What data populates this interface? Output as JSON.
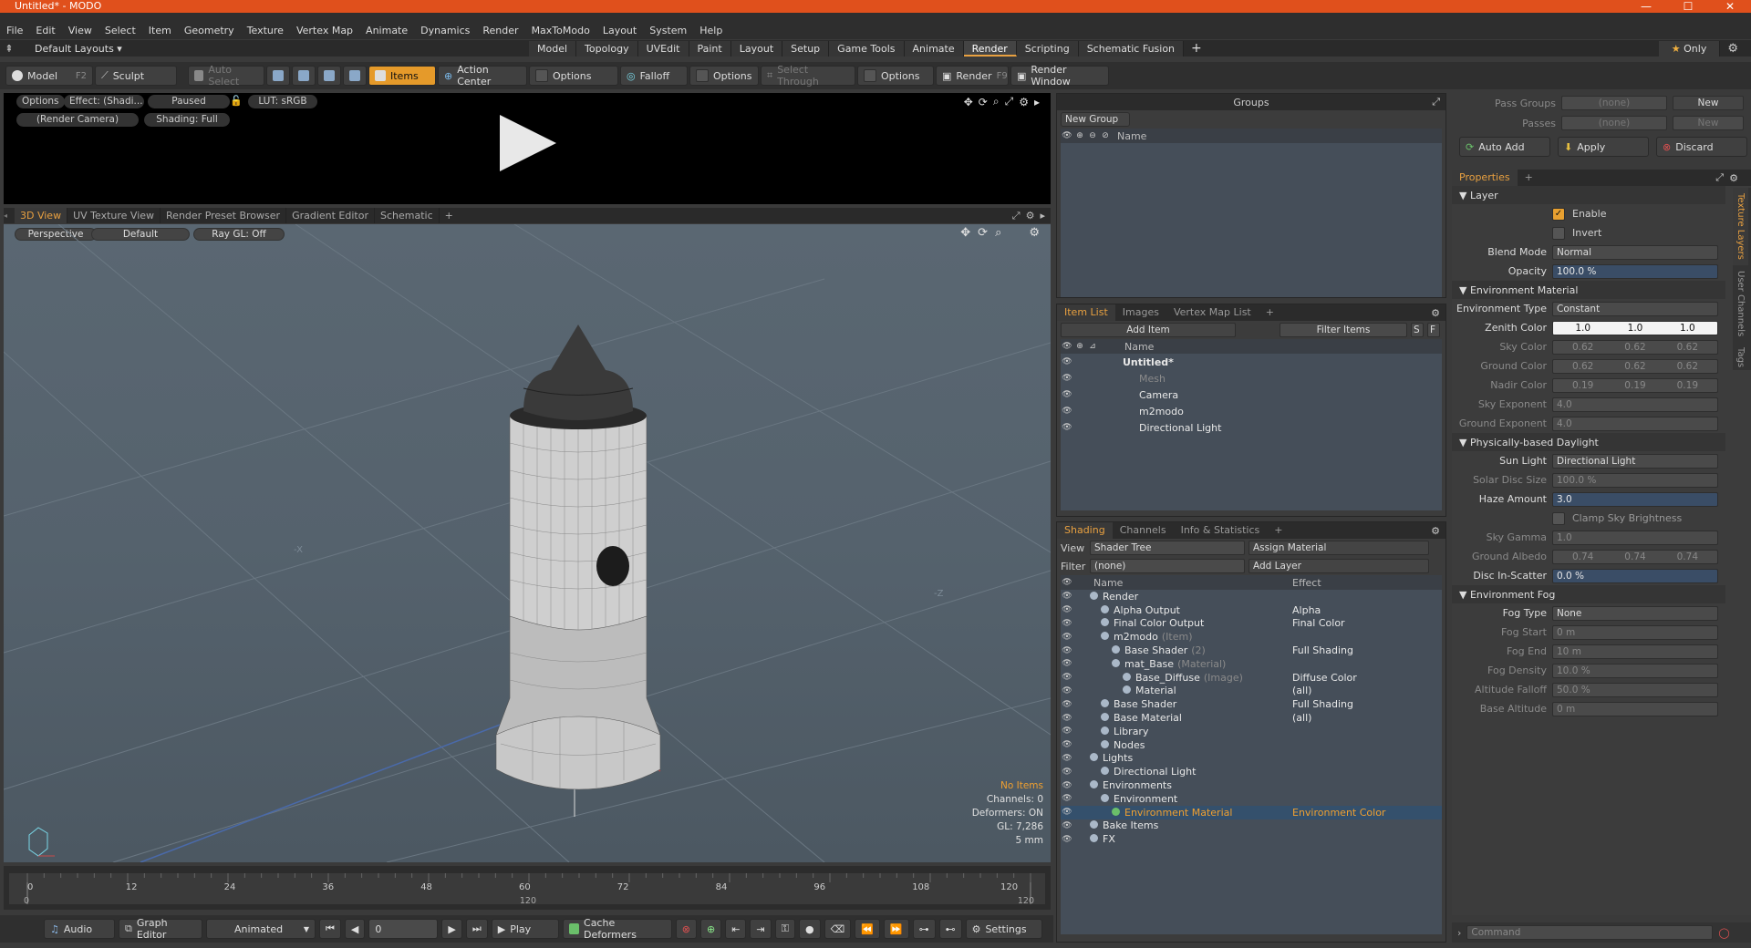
{
  "window": {
    "title": "Untitled* - MODO",
    "minimize": "—",
    "maximize": "☐",
    "close": "✕"
  },
  "menu": [
    "File",
    "Edit",
    "View",
    "Select",
    "Item",
    "Geometry",
    "Texture",
    "Vertex Map",
    "Animate",
    "Dynamics",
    "Render",
    "MaxToModo",
    "Layout",
    "System",
    "Help"
  ],
  "layouts": {
    "selector": "Default Layouts ▾",
    "tabs": [
      "Model",
      "Topology",
      "UVEdit",
      "Paint",
      "Layout",
      "Setup",
      "Game Tools",
      "Animate",
      "Render",
      "Scripting",
      "Schematic Fusion"
    ],
    "active_tab": "Render",
    "add": "+",
    "only": "Only"
  },
  "toolbar": {
    "model": "Model",
    "model_key": "F2",
    "sculpt": "Sculpt",
    "auto_select": "Auto Select",
    "items": "Items",
    "action_center": "Action Center",
    "options1": "Options",
    "falloff": "Falloff",
    "options2": "Options",
    "select_through": "Select Through",
    "options3": "Options",
    "render": "Render",
    "render_key": "F9",
    "render_window": "Render Window"
  },
  "render_view": {
    "options": "Options",
    "effect": "Effect: (Shadi...",
    "paused": "Paused",
    "lut": "LUT: sRGB",
    "camera": "(Render Camera)",
    "shading": "Shading: Full"
  },
  "viewport_tabs": [
    "3D View",
    "UV Texture View",
    "Render Preset Browser",
    "Gradient Editor",
    "Schematic"
  ],
  "viewport": {
    "perspective": "Perspective",
    "default": "Default",
    "raygl": "Ray GL: Off",
    "axis_x": "-X",
    "axis_z": "-Z",
    "info": [
      "No Items",
      "Channels: 0",
      "Deformers: ON",
      "GL: 7,286",
      "5 mm"
    ]
  },
  "timeline": {
    "ticks": [
      "0",
      "12",
      "24",
      "36",
      "48",
      "60",
      "72",
      "84",
      "96",
      "108",
      "120"
    ],
    "lower_ticks": [
      "0",
      "120",
      "120"
    ]
  },
  "bottom": {
    "audio": "Audio",
    "graph_editor": "Graph Editor",
    "animated": "Animated",
    "frame": "0",
    "play": "Play",
    "cache_deformers": "Cache Deformers",
    "settings": "Settings"
  },
  "groups": {
    "title": "Groups",
    "new_group": "New Group",
    "col_name": "Name"
  },
  "item_list": {
    "tabs": [
      "Item List",
      "Images",
      "Vertex Map List"
    ],
    "add_item": "Add Item",
    "filter": "Filter Items",
    "s": "S",
    "f": "F",
    "col_name": "Name",
    "rows": [
      {
        "label": "Untitled*",
        "indent": 0,
        "bold": true,
        "dim": false
      },
      {
        "label": "Mesh",
        "indent": 1,
        "bold": false,
        "dim": true
      },
      {
        "label": "Camera",
        "indent": 1,
        "bold": false,
        "dim": false
      },
      {
        "label": "m2modo",
        "indent": 1,
        "bold": false,
        "dim": false
      },
      {
        "label": "Directional Light",
        "indent": 1,
        "bold": false,
        "dim": false
      }
    ]
  },
  "shading": {
    "tabs": [
      "Shading",
      "Channels",
      "Info & Statistics"
    ],
    "view_label": "View",
    "view_value": "Shader Tree",
    "assign": "Assign Material",
    "filter_label": "Filter",
    "filter_value": "(none)",
    "add_layer": "Add Layer",
    "col_name": "Name",
    "col_effect": "Effect",
    "rows": [
      {
        "label": "Render",
        "sub": "",
        "effect": "",
        "indent": 0,
        "sel": false
      },
      {
        "label": "Alpha Output",
        "sub": "",
        "effect": "Alpha",
        "indent": 1,
        "sel": false
      },
      {
        "label": "Final Color Output",
        "sub": "",
        "effect": "Final Color",
        "indent": 1,
        "sel": false
      },
      {
        "label": "m2modo",
        "sub": "(Item)",
        "effect": "",
        "indent": 1,
        "sel": false
      },
      {
        "label": "Base Shader",
        "sub": "(2)",
        "effect": "Full Shading",
        "indent": 2,
        "sel": false
      },
      {
        "label": "mat_Base",
        "sub": "(Material)",
        "effect": "",
        "indent": 2,
        "sel": false
      },
      {
        "label": "Base_Diffuse",
        "sub": "(Image)",
        "effect": "Diffuse Color",
        "indent": 3,
        "sel": false
      },
      {
        "label": "Material",
        "sub": "",
        "effect": "(all)",
        "indent": 3,
        "sel": false
      },
      {
        "label": "Base Shader",
        "sub": "",
        "effect": "Full Shading",
        "indent": 1,
        "sel": false
      },
      {
        "label": "Base Material",
        "sub": "",
        "effect": "(all)",
        "indent": 1,
        "sel": false
      },
      {
        "label": "Library",
        "sub": "",
        "effect": "",
        "indent": 1,
        "sel": false
      },
      {
        "label": "Nodes",
        "sub": "",
        "effect": "",
        "indent": 1,
        "sel": false
      },
      {
        "label": "Lights",
        "sub": "",
        "effect": "",
        "indent": 0,
        "sel": false
      },
      {
        "label": "Directional Light",
        "sub": "",
        "effect": "",
        "indent": 1,
        "sel": false
      },
      {
        "label": "Environments",
        "sub": "",
        "effect": "",
        "indent": 0,
        "sel": false
      },
      {
        "label": "Environment",
        "sub": "",
        "effect": "",
        "indent": 1,
        "sel": false
      },
      {
        "label": "Environment Material",
        "sub": "",
        "effect": "Environment Color",
        "indent": 2,
        "sel": true
      },
      {
        "label": "Bake Items",
        "sub": "",
        "effect": "",
        "indent": 0,
        "sel": false
      },
      {
        "label": "FX",
        "sub": "",
        "effect": "",
        "indent": 0,
        "sel": false
      }
    ]
  },
  "passes": {
    "pass_groups": "Pass Groups",
    "pass_groups_value": "(none)",
    "new": "New",
    "passes": "Passes",
    "passes_value": "(none)",
    "new2": "New",
    "auto_add": "Auto Add",
    "apply": "Apply",
    "discard": "Discard"
  },
  "properties": {
    "tab": "Properties",
    "side_tabs": [
      "Texture Layers",
      "User Channels",
      "Tags"
    ],
    "layer": "Layer",
    "enable": "Enable",
    "invert": "Invert",
    "blend_mode": "Blend Mode",
    "blend_value": "Normal",
    "opacity": "Opacity",
    "opacity_value": "100.0 %",
    "env_material": "Environment Material",
    "env_type": "Environment Type",
    "env_type_value": "Constant",
    "zenith": "Zenith Color",
    "zenith_vals": [
      "1.0",
      "1.0",
      "1.0"
    ],
    "sky": "Sky Color",
    "sky_vals": [
      "0.62",
      "0.62",
      "0.62"
    ],
    "ground": "Ground Color",
    "ground_vals": [
      "0.62",
      "0.62",
      "0.62"
    ],
    "nadir": "Nadir Color",
    "nadir_vals": [
      "0.19",
      "0.19",
      "0.19"
    ],
    "sky_exp": "Sky Exponent",
    "sky_exp_value": "4.0",
    "ground_exp": "Ground Exponent",
    "ground_exp_value": "4.0",
    "pbd": "Physically-based Daylight",
    "sun_light": "Sun Light",
    "sun_light_value": "Directional Light",
    "solar_disc": "Solar Disc Size",
    "solar_disc_value": "100.0 %",
    "haze": "Haze Amount",
    "haze_value": "3.0",
    "clamp": "Clamp Sky Brightness",
    "sky_gamma": "Sky Gamma",
    "sky_gamma_value": "1.0",
    "ground_albedo": "Ground Albedo",
    "albedo_vals": [
      "0.74",
      "0.74",
      "0.74"
    ],
    "disc_in": "Disc In-Scatter",
    "disc_in_value": "0.0 %",
    "env_fog": "Environment Fog",
    "fog_type": "Fog Type",
    "fog_type_value": "None",
    "fog_start": "Fog Start",
    "fog_start_value": "0 m",
    "fog_end": "Fog End",
    "fog_end_value": "10 m",
    "fog_density": "Fog Density",
    "fog_density_value": "10.0 %",
    "alt_falloff": "Altitude Falloff",
    "alt_falloff_value": "50.0 %",
    "base_alt": "Base Altitude",
    "base_alt_value": "0 m",
    "command": "Command"
  }
}
